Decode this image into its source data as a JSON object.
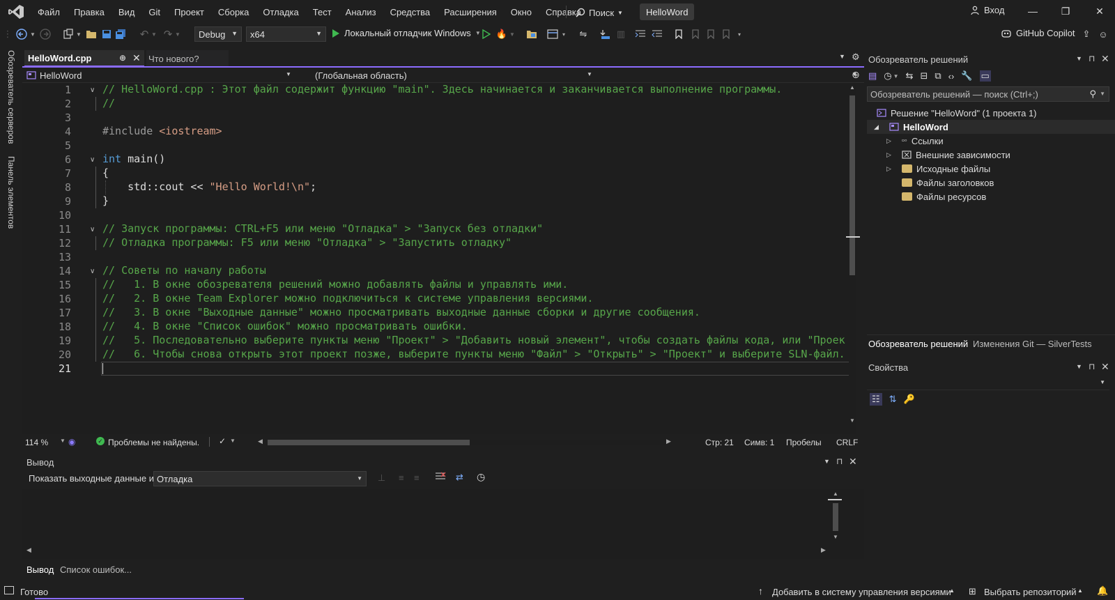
{
  "menu": [
    "Файл",
    "Правка",
    "Вид",
    "Git",
    "Проект",
    "Сборка",
    "Отладка",
    "Тест",
    "Анализ",
    "Средства",
    "Расширения",
    "Окно",
    "Справка"
  ],
  "search_label": "Поиск",
  "solution_title": "HelloWord",
  "signin_label": "Вход",
  "toolbar": {
    "config": "Debug",
    "platform": "x64",
    "debugger": "Локальный отладчик Windows",
    "copilot": "GitHub Copilot"
  },
  "side_tabs": [
    "Обозреватель серверов",
    "Панель элементов"
  ],
  "tabs": {
    "active": "HelloWord.cpp",
    "inactive": "Что нового?"
  },
  "nav": {
    "project": "HelloWord",
    "scope": "(Глобальная область)"
  },
  "code": {
    "line_numbers": [
      "1",
      "2",
      "3",
      "4",
      "5",
      "6",
      "7",
      "8",
      "9",
      "10",
      "11",
      "12",
      "13",
      "14",
      "15",
      "16",
      "17",
      "18",
      "19",
      "20",
      "21"
    ],
    "l1": "// HelloWord.cpp : Этот файл содержит функцию \"main\". Здесь начинается и заканчивается выполнение программы.",
    "l2": "//",
    "l4_directive": "#include ",
    "l4_header": "<iostream>",
    "l6_kw": "int",
    "l6_rest": " main()",
    "l7": "{",
    "l8_code": "    std::cout << ",
    "l8_str": "\"Hello World!\\n\"",
    "l8_end": ";",
    "l9": "}",
    "l11": "// Запуск программы: CTRL+F5 или меню \"Отладка\" > \"Запуск без отладки\"",
    "l12": "// Отладка программы: F5 или меню \"Отладка\" > \"Запустить отладку\"",
    "l14": "// Советы по началу работы",
    "l15": "//   1. В окне обозревателя решений можно добавлять файлы и управлять ими.",
    "l16": "//   2. В окне Team Explorer можно подключиться к системе управления версиями.",
    "l17": "//   3. В окне \"Выходные данные\" можно просматривать выходные данные сборки и другие сообщения.",
    "l18": "//   4. В окне \"Список ошибок\" можно просматривать ошибки.",
    "l19": "//   5. Последовательно выберите пункты меню \"Проект\" > \"Добавить новый элемент\", чтобы создать файлы кода, или \"Проек",
    "l20": "//   6. Чтобы снова открыть этот проект позже, выберите пункты меню \"Файл\" > \"Открыть\" > \"Проект\" и выберите SLN-файл."
  },
  "editor_status": {
    "zoom": "114 %",
    "issues": "Проблемы не найдены.",
    "line": "Стр: 21",
    "col": "Симв: 1",
    "whitespace": "Пробелы",
    "eol": "CRLF"
  },
  "output": {
    "title": "Вывод",
    "show_from_label": "Показать выходные данные из:",
    "source": "Отладка",
    "tabs": [
      "Вывод",
      "Список ошибок..."
    ]
  },
  "solution_explorer": {
    "title": "Обозреватель решений",
    "search_placeholder": "Обозреватель решений — поиск (Ctrl+;)",
    "solution_node": "Решение \"HelloWord\"  (1 проекта 1)",
    "project_node": "HelloWord",
    "items": [
      "Ссылки",
      "Внешние зависимости",
      "Исходные файлы",
      "Файлы заголовков",
      "Файлы ресурсов"
    ],
    "bottom_tabs": [
      "Обозреватель решений",
      "Изменения Git — SilverTests"
    ]
  },
  "properties": {
    "title": "Свойства"
  },
  "statusbar": {
    "ready": "Готово",
    "add_vcs": "Добавить в систему управления версиями",
    "select_repo": "Выбрать репозиторий"
  },
  "colors": {
    "accent": "#8b6cff",
    "comment": "#57a64a",
    "keyword": "#569cd6",
    "string": "#d69d85",
    "success": "#3fb950"
  }
}
